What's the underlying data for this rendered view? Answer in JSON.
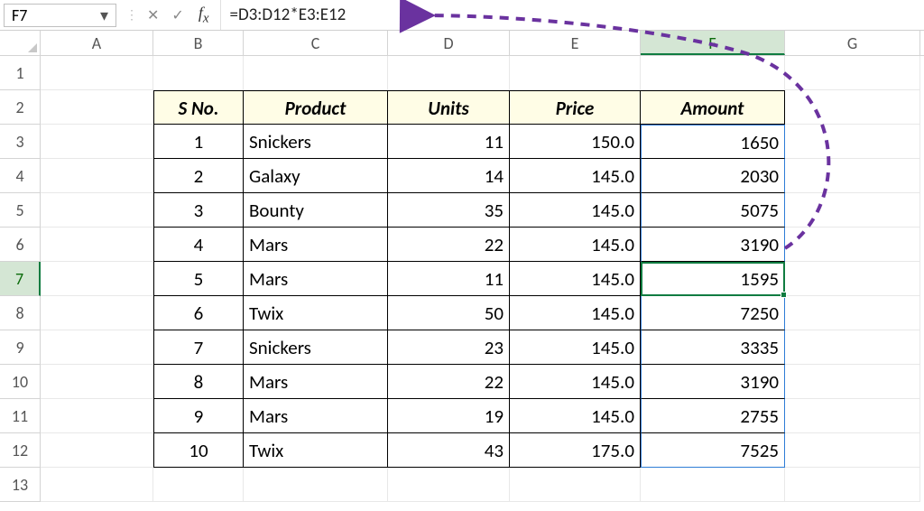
{
  "nameBox": "F7",
  "formula": "=D3:D12*E3:E12",
  "columns": [
    "A",
    "B",
    "C",
    "D",
    "E",
    "F",
    "G"
  ],
  "rowNumbers": [
    "1",
    "2",
    "3",
    "4",
    "5",
    "6",
    "7",
    "8",
    "9",
    "10",
    "11",
    "12",
    "13"
  ],
  "headers": {
    "sno": "S No.",
    "product": "Product",
    "units": "Units",
    "price": "Price",
    "amount": "Amount"
  },
  "rows": [
    {
      "sno": "1",
      "product": "Snickers",
      "units": "11",
      "price": "150.0",
      "amount": "1650"
    },
    {
      "sno": "2",
      "product": "Galaxy",
      "units": "14",
      "price": "145.0",
      "amount": "2030"
    },
    {
      "sno": "3",
      "product": "Bounty",
      "units": "35",
      "price": "145.0",
      "amount": "5075"
    },
    {
      "sno": "4",
      "product": "Mars",
      "units": "22",
      "price": "145.0",
      "amount": "3190"
    },
    {
      "sno": "5",
      "product": "Mars",
      "units": "11",
      "price": "145.0",
      "amount": "1595"
    },
    {
      "sno": "6",
      "product": "Twix",
      "units": "50",
      "price": "145.0",
      "amount": "7250"
    },
    {
      "sno": "7",
      "product": "Snickers",
      "units": "23",
      "price": "145.0",
      "amount": "3335"
    },
    {
      "sno": "8",
      "product": "Mars",
      "units": "22",
      "price": "145.0",
      "amount": "3190"
    },
    {
      "sno": "9",
      "product": "Mars",
      "units": "19",
      "price": "145.0",
      "amount": "2755"
    },
    {
      "sno": "10",
      "product": "Twix",
      "units": "43",
      "price": "175.0",
      "amount": "7525"
    }
  ],
  "selected": {
    "col": "F",
    "row": "7"
  },
  "colors": {
    "accent": "#107c41",
    "arrow": "#6a329f",
    "spill": "#2e7dd6",
    "headerBg": "#fffde6"
  }
}
